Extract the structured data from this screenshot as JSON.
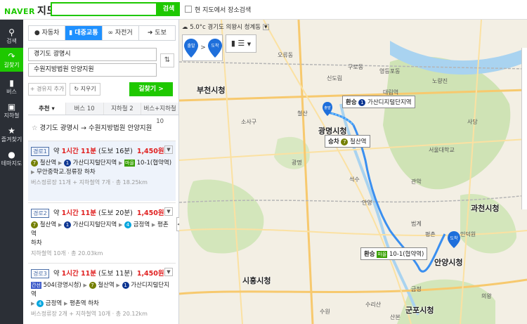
{
  "header": {
    "logo": "NAVER",
    "service": "지도",
    "search_value": "",
    "search_button": "검색",
    "checkbox_label": "현 지도에서 장소검색"
  },
  "nav": [
    {
      "icon": "search-icon",
      "label": "검색"
    },
    {
      "icon": "directions-icon",
      "label": "길찾기"
    },
    {
      "icon": "bus-icon",
      "label": "버스"
    },
    {
      "icon": "subway-icon",
      "label": "지하철"
    },
    {
      "icon": "star-icon",
      "label": "즐겨찾기"
    },
    {
      "icon": "theme-map-icon",
      "label": "테마지도"
    }
  ],
  "modes": [
    "자동차",
    "대중교통",
    "자전거",
    "도보"
  ],
  "route": {
    "from": "경기도 광명시",
    "to": "수원지방법원 안양지원",
    "add_waypoint": "+ 경유지 추가",
    "clear": "지우기",
    "go": "길찾기 >",
    "tabs": [
      "추천",
      "버스 10",
      "지하철 2",
      "버스+지하철 10"
    ],
    "summary": "경기도 광명시 → 수원지방법원 안양지원"
  },
  "results": [
    {
      "label": "경로1",
      "time_prefix": "약",
      "time_main": "1시간 11분",
      "walk": "(도보 16분)",
      "fare": "1,450원",
      "step1": [
        "철산역",
        "가산디지털단지역",
        "마을",
        "10-1(협약역)"
      ],
      "step2": "무안중학교.정류장 하차",
      "meta": "버스정류장 11개 + 지하철역 7개 · 총 18.25km"
    },
    {
      "label": "경로2",
      "time_prefix": "약",
      "time_main": "1시간 11분",
      "walk": "(도보 20분)",
      "fare": "1,450원",
      "step1": [
        "철산역",
        "가산디지털단지역",
        "금정역",
        "평촌역"
      ],
      "step2": "하차",
      "meta": "지하철역 10개 · 총 20.03km"
    },
    {
      "label": "경로3",
      "time_prefix": "약",
      "time_main": "1시간 11분",
      "walk": "(도보 11분)",
      "fare": "1,450원",
      "bus_badge": "간선",
      "step1": [
        "504(광명시청)",
        "철산역",
        "가산디지털단지역"
      ],
      "step2": [
        "금정역",
        "평촌역 하차"
      ],
      "meta": "버스정류장 2개 + 지하철역 10개 · 총 20.12km"
    }
  ],
  "map": {
    "weather": "5.0°c 경기도 의왕시 청계동",
    "start_label": "출발",
    "end_label": "도착",
    "transfer1": "환승",
    "transfer1_station": "가산디지털단지역",
    "board": "승차",
    "board_station": "철산역",
    "transfer2": "환승",
    "transfer2_bus_type": "마을",
    "transfer2_bus": "10-1(협약역)",
    "cities": [
      "부천시청",
      "광명시청",
      "시흥시청",
      "안양시청",
      "과천시청",
      "군포시청"
    ],
    "districts": [
      "오류동",
      "구로동",
      "영등포동",
      "신도림",
      "대림역",
      "소사구",
      "철산",
      "광명",
      "안양",
      "석수",
      "관악",
      "평촌",
      "범계",
      "인덕원",
      "금정",
      "산본",
      "의왕",
      "수리산",
      "수원",
      "노량진",
      "사당",
      "서울대학교"
    ]
  }
}
